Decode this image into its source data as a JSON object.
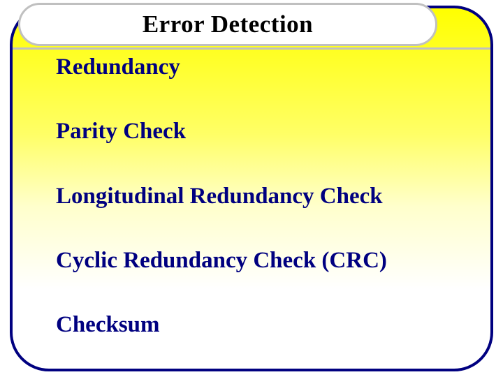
{
  "slide": {
    "title": "Error Detection",
    "items": [
      "Redundancy",
      "Parity Check",
      "Longitudinal Redundancy Check",
      "Cyclic Redundancy Check (CRC)",
      "Checksum"
    ]
  }
}
